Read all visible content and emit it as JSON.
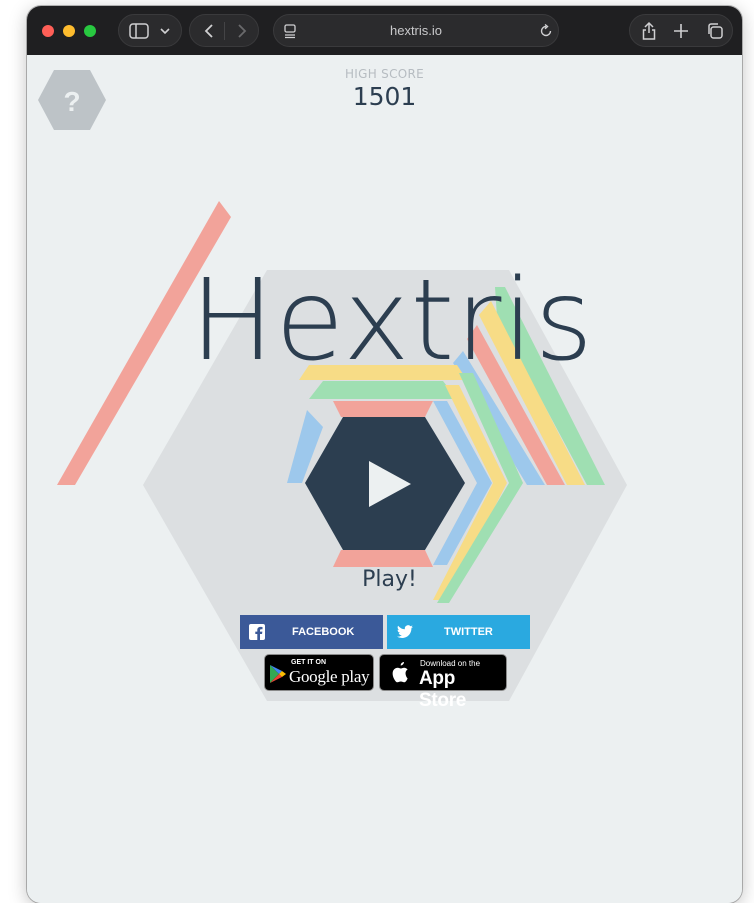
{
  "browser": {
    "url": "hextris.io",
    "traffic_lights": [
      "#ff5f57",
      "#febc2e",
      "#28c840"
    ]
  },
  "game": {
    "help_glyph": "?",
    "high_score_label": "HIGH SCORE",
    "high_score_value": "1501",
    "title": "Hextris",
    "play_label": "Play!",
    "colors": {
      "dark": "#2c3e50",
      "red": "#e74c3c",
      "yellow": "#f1c40f",
      "green": "#2ecc71",
      "blue": "#3498db",
      "background": "#ecf0f1"
    }
  },
  "share": {
    "facebook_label": "FACEBOOK",
    "twitter_label": "TWITTER",
    "facebook_color": "#3b5998",
    "twitter_color": "#2aa9e0"
  },
  "stores": {
    "google_small": "GET IT ON",
    "google_big": "Google play",
    "apple_small": "Download on the",
    "apple_big": "App Store"
  }
}
